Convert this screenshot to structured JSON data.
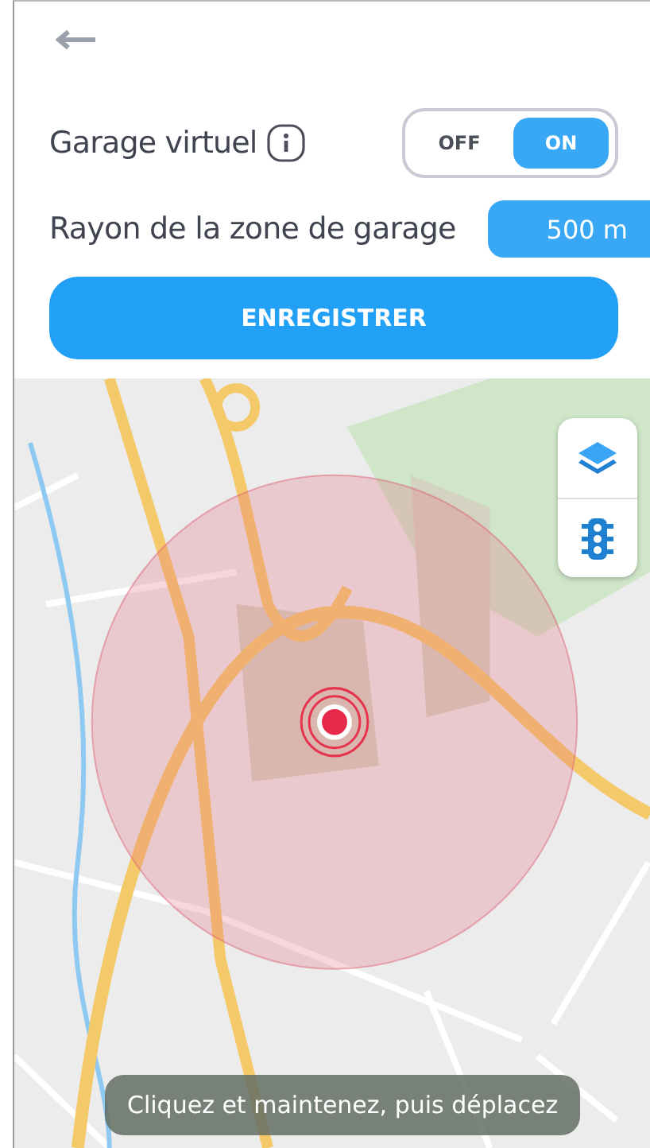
{
  "virtual_garage": {
    "label": "Garage virtuel",
    "options": [
      {
        "label": "OFF",
        "selected": false
      },
      {
        "label": "ON",
        "selected": true
      }
    ]
  },
  "radius": {
    "label": "Rayon de la zone de garage",
    "value": "500 m"
  },
  "save_button": {
    "label": "ENREGISTRER"
  },
  "map": {
    "controls": [
      {
        "kind": "layers"
      },
      {
        "kind": "traffic"
      }
    ],
    "toast": "Cliquez et maintenez, puis déplacez"
  }
}
